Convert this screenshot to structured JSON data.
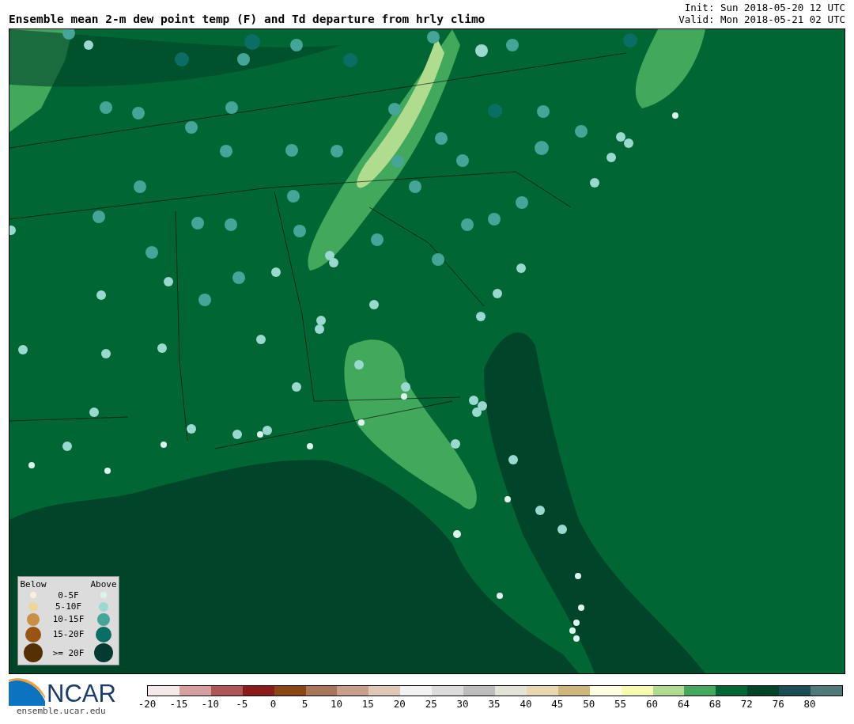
{
  "title": "Ensemble mean 2-m dew point temp (F) and Td departure from hrly climo",
  "init": "Init: Sun 2018-05-20 12 UTC",
  "valid": "Valid: Mon 2018-05-21 02 UTC",
  "legend": {
    "below_heading": "Below",
    "above_heading": "Above",
    "rows": [
      {
        "label": "0-5F",
        "dots": [
          {
            "color": "#fbeedd"
          },
          {
            "color": "#ddf3ee"
          }
        ]
      },
      {
        "label": "5-10F",
        "dots": [
          {
            "color": "#eed69a"
          },
          {
            "color": "#9ad9d0"
          }
        ]
      },
      {
        "label": "10-15F",
        "dots": [
          {
            "color": "#c98f45"
          },
          {
            "color": "#45a598"
          }
        ]
      },
      {
        "label": "15-20F",
        "dots": [
          {
            "color": "#975412"
          },
          {
            "color": "#0b6e65"
          }
        ]
      },
      {
        "label": ">= 20F",
        "dots": [
          {
            "color": "#553005"
          },
          {
            "color": "#033b33"
          }
        ]
      }
    ]
  },
  "logo": {
    "name": "NCAR",
    "url": "ensemble.ucar.edu"
  },
  "colorbar": {
    "segments": [
      {
        "color": "#f5e8e8"
      },
      {
        "color": "#d6a0a0"
      },
      {
        "color": "#b05555"
      },
      {
        "color": "#8b1a1a"
      },
      {
        "color": "#8b4513"
      },
      {
        "color": "#a8775a"
      },
      {
        "color": "#c8a08a"
      },
      {
        "color": "#e0c8b8"
      },
      {
        "color": "#f2f2f2"
      },
      {
        "color": "#dcdcdc"
      },
      {
        "color": "#bdbdbd"
      },
      {
        "color": "#e4e4d6"
      },
      {
        "color": "#e8d8b0"
      },
      {
        "color": "#cdb87a"
      },
      {
        "color": "#ffffe0"
      },
      {
        "color": "#f7fbb0"
      },
      {
        "color": "#b0dc90"
      },
      {
        "color": "#41a85c"
      },
      {
        "color": "#006633"
      },
      {
        "color": "#00442a"
      },
      {
        "color": "#1b4f55"
      },
      {
        "color": "#4f7a7a"
      }
    ],
    "ticks": [
      "-20",
      "-15",
      "-10",
      "-5",
      "0",
      "5",
      "10",
      "15",
      "20",
      "25",
      "30",
      "35",
      "40",
      "45",
      "50",
      "55",
      "60",
      "64",
      "68",
      "72",
      "76",
      "80"
    ]
  }
}
